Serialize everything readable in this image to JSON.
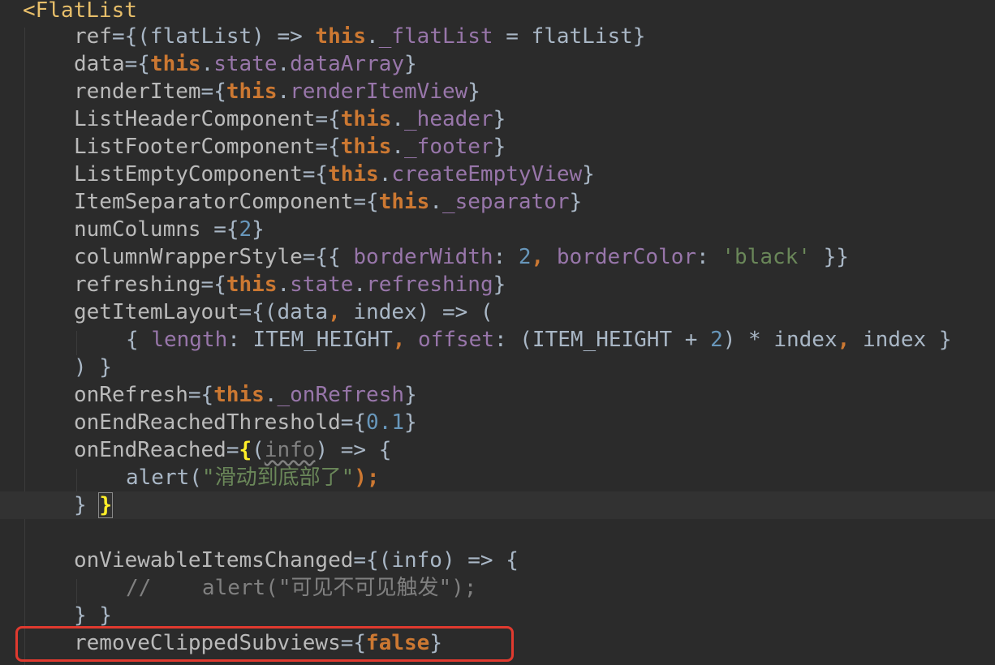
{
  "editor": {
    "lines": [
      [
        {
          "t": "<FlatList",
          "c": "tag"
        }
      ],
      [
        {
          "t": "ref",
          "c": "attr"
        },
        {
          "t": "={(flatList) => ",
          "c": "punct"
        },
        {
          "t": "this",
          "c": "kw"
        },
        {
          "t": ".",
          "c": "punct"
        },
        {
          "t": "_flatList",
          "c": "field"
        },
        {
          "t": " = flatList}",
          "c": "punct"
        }
      ],
      [
        {
          "t": "data",
          "c": "attr"
        },
        {
          "t": "={",
          "c": "punct"
        },
        {
          "t": "this",
          "c": "kw"
        },
        {
          "t": ".",
          "c": "punct"
        },
        {
          "t": "state",
          "c": "field"
        },
        {
          "t": ".",
          "c": "punct"
        },
        {
          "t": "dataArray",
          "c": "field"
        },
        {
          "t": "}",
          "c": "punct"
        }
      ],
      [
        {
          "t": "renderItem",
          "c": "attr"
        },
        {
          "t": "={",
          "c": "punct"
        },
        {
          "t": "this",
          "c": "kw"
        },
        {
          "t": ".",
          "c": "punct"
        },
        {
          "t": "renderItemView",
          "c": "field"
        },
        {
          "t": "}",
          "c": "punct"
        }
      ],
      [
        {
          "t": "ListHeaderComponent",
          "c": "attr"
        },
        {
          "t": "={",
          "c": "punct"
        },
        {
          "t": "this",
          "c": "kw"
        },
        {
          "t": ".",
          "c": "punct"
        },
        {
          "t": "_header",
          "c": "field"
        },
        {
          "t": "}",
          "c": "punct"
        }
      ],
      [
        {
          "t": "ListFooterComponent",
          "c": "attr"
        },
        {
          "t": "={",
          "c": "punct"
        },
        {
          "t": "this",
          "c": "kw"
        },
        {
          "t": ".",
          "c": "punct"
        },
        {
          "t": "_footer",
          "c": "field"
        },
        {
          "t": "}",
          "c": "punct"
        }
      ],
      [
        {
          "t": "ListEmptyComponent",
          "c": "attr"
        },
        {
          "t": "={",
          "c": "punct"
        },
        {
          "t": "this",
          "c": "kw"
        },
        {
          "t": ".",
          "c": "punct"
        },
        {
          "t": "createEmptyView",
          "c": "field"
        },
        {
          "t": "}",
          "c": "punct"
        }
      ],
      [
        {
          "t": "ItemSeparatorComponent",
          "c": "attr"
        },
        {
          "t": "={",
          "c": "punct"
        },
        {
          "t": "this",
          "c": "kw"
        },
        {
          "t": ".",
          "c": "punct"
        },
        {
          "t": "_separator",
          "c": "field"
        },
        {
          "t": "}",
          "c": "punct"
        }
      ],
      [
        {
          "t": "numColumns ",
          "c": "attr"
        },
        {
          "t": "={",
          "c": "punct"
        },
        {
          "t": "2",
          "c": "num"
        },
        {
          "t": "}",
          "c": "punct"
        }
      ],
      [
        {
          "t": "columnWrapperStyle",
          "c": "attr"
        },
        {
          "t": "={{ ",
          "c": "punct"
        },
        {
          "t": "borderWidth",
          "c": "field"
        },
        {
          "t": ": ",
          "c": "punct"
        },
        {
          "t": "2",
          "c": "num"
        },
        {
          "t": ", ",
          "c": "kw"
        },
        {
          "t": "borderColor",
          "c": "field"
        },
        {
          "t": ": ",
          "c": "punct"
        },
        {
          "t": "'black'",
          "c": "str"
        },
        {
          "t": " }}",
          "c": "punct"
        }
      ],
      [
        {
          "t": "refreshing",
          "c": "attr"
        },
        {
          "t": "={",
          "c": "punct"
        },
        {
          "t": "this",
          "c": "kw"
        },
        {
          "t": ".",
          "c": "punct"
        },
        {
          "t": "state",
          "c": "field"
        },
        {
          "t": ".",
          "c": "punct"
        },
        {
          "t": "refreshing",
          "c": "field"
        },
        {
          "t": "}",
          "c": "punct"
        }
      ],
      [
        {
          "t": "getItemLayout",
          "c": "attr"
        },
        {
          "t": "={(data",
          "c": "punct"
        },
        {
          "t": ", ",
          "c": "kw"
        },
        {
          "t": "index) => (",
          "c": "punct"
        }
      ],
      [
        {
          "t": "{ ",
          "c": "punct"
        },
        {
          "t": "length",
          "c": "field"
        },
        {
          "t": ": ITEM_HEIGHT",
          "c": "punct"
        },
        {
          "t": ", ",
          "c": "kw"
        },
        {
          "t": "offset",
          "c": "field"
        },
        {
          "t": ": (ITEM_HEIGHT + ",
          "c": "punct"
        },
        {
          "t": "2",
          "c": "num"
        },
        {
          "t": ") * index",
          "c": "punct"
        },
        {
          "t": ", ",
          "c": "kw"
        },
        {
          "t": "index }",
          "c": "punct"
        }
      ],
      [
        {
          "t": ") }",
          "c": "punct"
        }
      ],
      [
        {
          "t": "onRefresh",
          "c": "attr"
        },
        {
          "t": "={",
          "c": "punct"
        },
        {
          "t": "this",
          "c": "kw"
        },
        {
          "t": ".",
          "c": "punct"
        },
        {
          "t": "_onRefresh",
          "c": "field"
        },
        {
          "t": "}",
          "c": "punct"
        }
      ],
      [
        {
          "t": "onEndReachedThreshold",
          "c": "attr"
        },
        {
          "t": "={",
          "c": "punct"
        },
        {
          "t": "0.1",
          "c": "num"
        },
        {
          "t": "}",
          "c": "punct"
        }
      ],
      [
        {
          "t": "onEndReached",
          "c": "attr"
        },
        {
          "t": "=",
          "c": "punct"
        },
        {
          "t": "{",
          "c": "brace-hl"
        },
        {
          "t": "(",
          "c": "punct"
        },
        {
          "t": "info",
          "c": "unused"
        },
        {
          "t": ") => {",
          "c": "punct"
        }
      ],
      [
        {
          "t": "alert(",
          "c": "punct"
        },
        {
          "t": "\"滑动到底部了\"",
          "c": "str"
        },
        {
          "t": ");",
          "c": "kw"
        }
      ],
      [
        {
          "t": "} ",
          "c": "punct"
        },
        {
          "t": "}",
          "c": "brace-hl"
        }
      ],
      [],
      [
        {
          "t": "onViewableItemsChanged",
          "c": "attr"
        },
        {
          "t": "={(info) => {",
          "c": "punct"
        }
      ],
      [
        {
          "t": "//    alert(\"可见不可见触发\");",
          "c": "cmt"
        }
      ],
      [
        {
          "t": "} }",
          "c": "punct"
        }
      ],
      [
        {
          "t": "removeClippedSubviews",
          "c": "attr"
        },
        {
          "t": "={",
          "c": "punct"
        },
        {
          "t": "false",
          "c": "kw"
        },
        {
          "t": "}",
          "c": "punct"
        }
      ]
    ]
  }
}
